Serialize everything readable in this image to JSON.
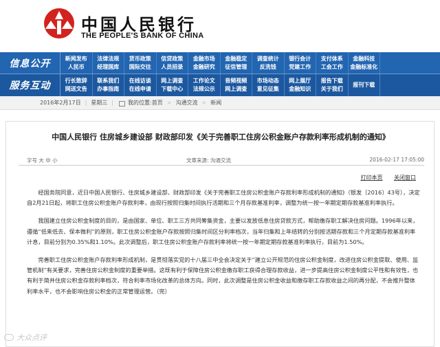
{
  "header": {
    "title_cn": "中国人民银行",
    "title_en": "THE PEOPLE'S BANK OF CHINA"
  },
  "nav": {
    "row1_label": "信息公开",
    "row1": [
      [
        "新闻发布",
        "人民币"
      ],
      [
        "法律法规",
        "经理国库"
      ],
      [
        "货币政策",
        "国际交往"
      ],
      [
        "信贷政策",
        "人员招录"
      ],
      [
        "金融市场",
        "金融研究"
      ],
      [
        "金融稳定",
        "征信管理"
      ],
      [
        "调查统计",
        "反洗钱"
      ],
      [
        "银行会计",
        "党建工作"
      ],
      [
        "支付体系",
        "工会工作"
      ],
      [
        "金融科技",
        "金融标准化"
      ]
    ],
    "row2_label": "服务互动",
    "row2": [
      [
        "行长致辞",
        "网送文告"
      ],
      [
        "联系我们",
        "办事指南"
      ],
      [
        "在线访谈",
        "在线申请"
      ],
      [
        "网上调查",
        "下载中心"
      ],
      [
        "工作论文",
        "法规公示"
      ],
      [
        "音频视频",
        "网上调查"
      ],
      [
        "市场动态",
        "意见征集"
      ],
      [
        "网上展厅",
        "金融知识"
      ],
      [
        "报告下载",
        "关于我们"
      ],
      [
        "报刊下载",
        ""
      ]
    ]
  },
  "datebar": {
    "date": "2016年2月17日",
    "weekday": "星期三",
    "location_label": "我的位置:首页",
    "crumb1": "沟通交流",
    "crumb2": "新闻"
  },
  "article": {
    "title": "中国人民银行 住房城乡建设部 财政部印发《关于完善职工住房公积金账户存款利率形成机制的通知》",
    "font_size_label": "字号 大 中 小",
    "source": "文章来源: 沟通交流",
    "datetime": "2016-02-17 17:05:00",
    "print_label": "打印本页",
    "close_label": "关闭窗口",
    "paragraphs": [
      "经国务院同意，近日中国人民银行、住房城乡建设部、财政部印发《关于完善职工住房公积金账户存款利率形成机制的通知》（银发〔2016〕43号），决定自2月21日起，将职工住房公积金账户存款利率，由现行按照归集时间执行活期和三个月存款基准利率，调整为统一按一年期定期存款基准利率执行。",
      "我国建立住房公积金制度的目的，是由国家、单位、职工三方共同筹集资金，主要以发放低息住房贷款方式，帮助缴存职工解决住房问题。1996年以来，遵循“低来低去、保本微利”的原则，职工住房公积金账户存款按照归集时间区分利率档次，当年归集和上年结转的分别按活期存款和三个月定期存款基准利率计息，目前分别为0.35%和1.10%。此次调整后，职工住房公积金账户存款利率将统一按一年期定期存款基准利率执行，目前为1.50%。",
      "完善职工住房公积金账户存款利率形成机制，是贯彻落实党的十八届三中全会决定关于“建立公开规范的住房公积金制度，改进住房公积金提取、使用、监管机制”有关要求，完善住房公积金制度的重要举措。这既有利于保障住房公积金缴存职工获得合理存款收益，进一步提高住房公积金制度公平性和有效性，也有利于简并住房公积金存款利率档次，符合利率市场化改革的总体方向。同时，此次调整是住房公积金收益和缴存职工存款收益之间的再分配，不会推升整体利率水平，也不会影响住房公积金的正常管理运营。（完）"
    ]
  },
  "watermark": "大众点评"
}
